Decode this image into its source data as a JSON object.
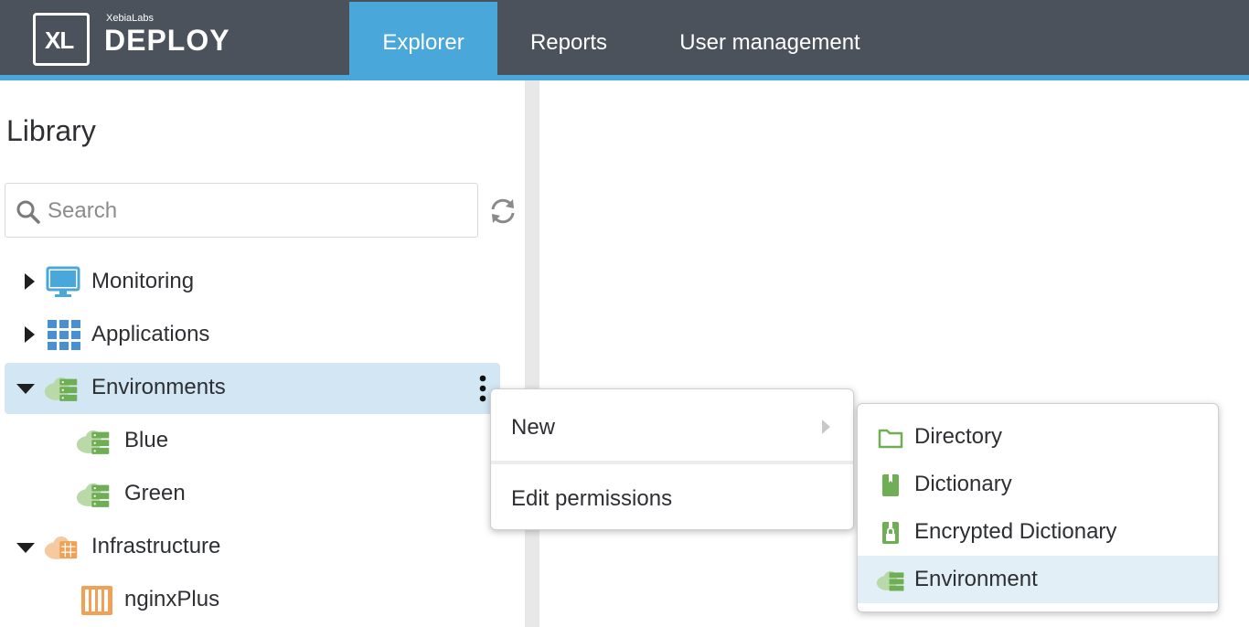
{
  "brand": {
    "logo_mark": "XL",
    "company": "XebiaLabs",
    "product": "DEPLOY"
  },
  "nav": {
    "tabs": [
      {
        "label": "Explorer",
        "active": true
      },
      {
        "label": "Reports",
        "active": false
      },
      {
        "label": "User management",
        "active": false
      }
    ]
  },
  "library": {
    "title": "Library",
    "search": {
      "placeholder": "Search",
      "value": ""
    },
    "refresh_icon": "refresh-icon",
    "tree": [
      {
        "label": "Monitoring",
        "icon": "monitor-icon",
        "expanded": false,
        "level": 0
      },
      {
        "label": "Applications",
        "icon": "grid-icon",
        "expanded": false,
        "level": 0
      },
      {
        "label": "Environments",
        "icon": "environment-cloud-icon",
        "expanded": true,
        "level": 0,
        "selected": true
      },
      {
        "label": "Blue",
        "icon": "environment-cloud-icon",
        "level": 1
      },
      {
        "label": "Green",
        "icon": "environment-cloud-icon",
        "level": 1
      },
      {
        "label": "Infrastructure",
        "icon": "infrastructure-cloud-icon",
        "expanded": true,
        "level": 0
      },
      {
        "label": "nginxPlus",
        "icon": "container-icon",
        "level": 1
      }
    ]
  },
  "context_menu": {
    "items": [
      {
        "label": "New",
        "has_submenu": true
      },
      {
        "label": "Edit permissions",
        "has_submenu": false
      }
    ]
  },
  "submenu": {
    "items": [
      {
        "label": "Directory",
        "icon": "folder-icon"
      },
      {
        "label": "Dictionary",
        "icon": "dictionary-icon"
      },
      {
        "label": "Encrypted Dictionary",
        "icon": "encrypted-dictionary-icon"
      },
      {
        "label": "Environment",
        "icon": "environment-cloud-icon",
        "highlighted": true
      }
    ]
  },
  "colors": {
    "topbar": "#4b525c",
    "accent": "#4aa7da",
    "selected_row": "#d3e6f3",
    "env_green": "#8cc075",
    "infra_orange": "#f0a155",
    "monitor_blue": "#4aa7da"
  }
}
